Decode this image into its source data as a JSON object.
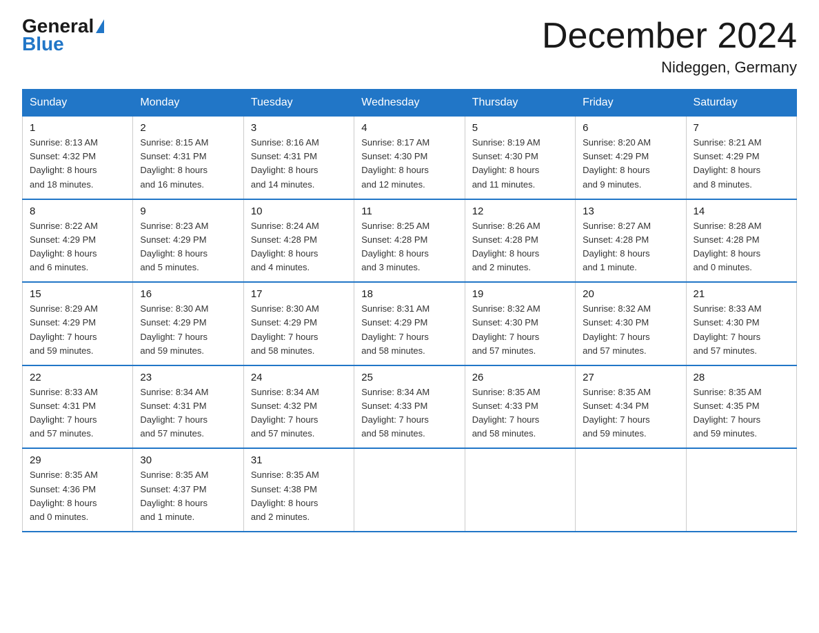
{
  "logo": {
    "general": "General",
    "blue": "Blue",
    "triangle_symbol": "▶"
  },
  "title": "December 2024",
  "subtitle": "Nideggen, Germany",
  "weekdays": [
    "Sunday",
    "Monday",
    "Tuesday",
    "Wednesday",
    "Thursday",
    "Friday",
    "Saturday"
  ],
  "weeks": [
    [
      {
        "day": "1",
        "sunrise": "8:13 AM",
        "sunset": "4:32 PM",
        "daylight": "8 hours and 18 minutes."
      },
      {
        "day": "2",
        "sunrise": "8:15 AM",
        "sunset": "4:31 PM",
        "daylight": "8 hours and 16 minutes."
      },
      {
        "day": "3",
        "sunrise": "8:16 AM",
        "sunset": "4:31 PM",
        "daylight": "8 hours and 14 minutes."
      },
      {
        "day": "4",
        "sunrise": "8:17 AM",
        "sunset": "4:30 PM",
        "daylight": "8 hours and 12 minutes."
      },
      {
        "day": "5",
        "sunrise": "8:19 AM",
        "sunset": "4:30 PM",
        "daylight": "8 hours and 11 minutes."
      },
      {
        "day": "6",
        "sunrise": "8:20 AM",
        "sunset": "4:29 PM",
        "daylight": "8 hours and 9 minutes."
      },
      {
        "day": "7",
        "sunrise": "8:21 AM",
        "sunset": "4:29 PM",
        "daylight": "8 hours and 8 minutes."
      }
    ],
    [
      {
        "day": "8",
        "sunrise": "8:22 AM",
        "sunset": "4:29 PM",
        "daylight": "8 hours and 6 minutes."
      },
      {
        "day": "9",
        "sunrise": "8:23 AM",
        "sunset": "4:29 PM",
        "daylight": "8 hours and 5 minutes."
      },
      {
        "day": "10",
        "sunrise": "8:24 AM",
        "sunset": "4:28 PM",
        "daylight": "8 hours and 4 minutes."
      },
      {
        "day": "11",
        "sunrise": "8:25 AM",
        "sunset": "4:28 PM",
        "daylight": "8 hours and 3 minutes."
      },
      {
        "day": "12",
        "sunrise": "8:26 AM",
        "sunset": "4:28 PM",
        "daylight": "8 hours and 2 minutes."
      },
      {
        "day": "13",
        "sunrise": "8:27 AM",
        "sunset": "4:28 PM",
        "daylight": "8 hours and 1 minute."
      },
      {
        "day": "14",
        "sunrise": "8:28 AM",
        "sunset": "4:28 PM",
        "daylight": "8 hours and 0 minutes."
      }
    ],
    [
      {
        "day": "15",
        "sunrise": "8:29 AM",
        "sunset": "4:29 PM",
        "daylight": "7 hours and 59 minutes."
      },
      {
        "day": "16",
        "sunrise": "8:30 AM",
        "sunset": "4:29 PM",
        "daylight": "7 hours and 59 minutes."
      },
      {
        "day": "17",
        "sunrise": "8:30 AM",
        "sunset": "4:29 PM",
        "daylight": "7 hours and 58 minutes."
      },
      {
        "day": "18",
        "sunrise": "8:31 AM",
        "sunset": "4:29 PM",
        "daylight": "7 hours and 58 minutes."
      },
      {
        "day": "19",
        "sunrise": "8:32 AM",
        "sunset": "4:30 PM",
        "daylight": "7 hours and 57 minutes."
      },
      {
        "day": "20",
        "sunrise": "8:32 AM",
        "sunset": "4:30 PM",
        "daylight": "7 hours and 57 minutes."
      },
      {
        "day": "21",
        "sunrise": "8:33 AM",
        "sunset": "4:30 PM",
        "daylight": "7 hours and 57 minutes."
      }
    ],
    [
      {
        "day": "22",
        "sunrise": "8:33 AM",
        "sunset": "4:31 PM",
        "daylight": "7 hours and 57 minutes."
      },
      {
        "day": "23",
        "sunrise": "8:34 AM",
        "sunset": "4:31 PM",
        "daylight": "7 hours and 57 minutes."
      },
      {
        "day": "24",
        "sunrise": "8:34 AM",
        "sunset": "4:32 PM",
        "daylight": "7 hours and 57 minutes."
      },
      {
        "day": "25",
        "sunrise": "8:34 AM",
        "sunset": "4:33 PM",
        "daylight": "7 hours and 58 minutes."
      },
      {
        "day": "26",
        "sunrise": "8:35 AM",
        "sunset": "4:33 PM",
        "daylight": "7 hours and 58 minutes."
      },
      {
        "day": "27",
        "sunrise": "8:35 AM",
        "sunset": "4:34 PM",
        "daylight": "7 hours and 59 minutes."
      },
      {
        "day": "28",
        "sunrise": "8:35 AM",
        "sunset": "4:35 PM",
        "daylight": "7 hours and 59 minutes."
      }
    ],
    [
      {
        "day": "29",
        "sunrise": "8:35 AM",
        "sunset": "4:36 PM",
        "daylight": "8 hours and 0 minutes."
      },
      {
        "day": "30",
        "sunrise": "8:35 AM",
        "sunset": "4:37 PM",
        "daylight": "8 hours and 1 minute."
      },
      {
        "day": "31",
        "sunrise": "8:35 AM",
        "sunset": "4:38 PM",
        "daylight": "8 hours and 2 minutes."
      },
      null,
      null,
      null,
      null
    ]
  ],
  "labels": {
    "sunrise": "Sunrise:",
    "sunset": "Sunset:",
    "daylight": "Daylight:"
  }
}
